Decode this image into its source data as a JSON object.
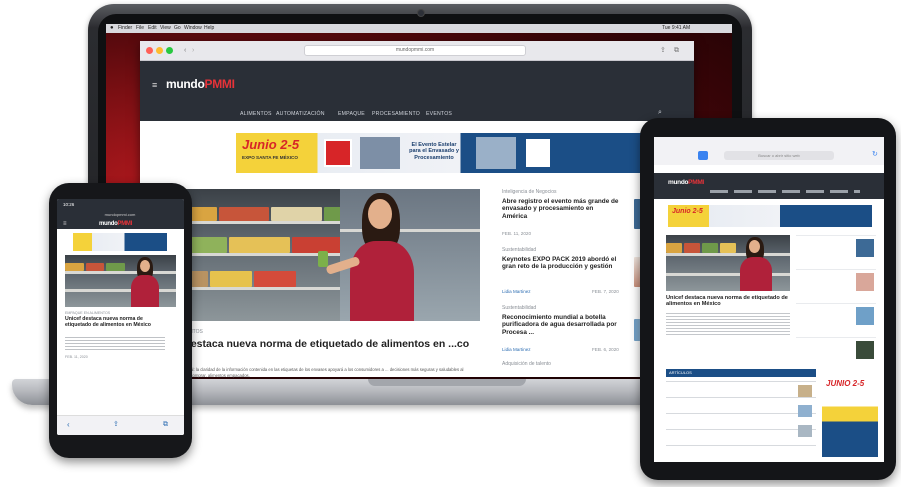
{
  "laptop": {
    "mac_menubar": {
      "items": [
        "Finder",
        "File",
        "Edit",
        "View",
        "Go",
        "Window",
        "Help"
      ],
      "clock": "Tue 9:41 AM"
    },
    "browser": {
      "url": "mundopmmi.com"
    },
    "site": {
      "logo_prefix": "mundo",
      "logo_brand": "PMMI",
      "nav": [
        "ALIMENTOS",
        "AUTOMATIZACIÓN",
        "EMPAQUE",
        "PROCESAMIENTO",
        "EVENTOS"
      ],
      "banner": {
        "date": "Junio 2-5",
        "venue": "EXPO SANTA FE MÉXICO",
        "text": "El Evento Estelar para el Envasado y Procesamiento"
      },
      "featured": {
        "section": "EN ALIMENTOS",
        "headline": "...el destaca nueva norma de etiquetado de alimentos en ...co",
        "excerpt": "...de una cabal: la claridad de la información contenida en las etiquetas de los envases apoyará a los consumidores a ... decisiones más seguras y saludables al momento de comprar. alimentos empacados."
      },
      "sidebar": [
        {
          "section": "Inteligencia de Negocios",
          "headline": "Abre registro el evento más grande de envasado y procesamiento en América",
          "author": "",
          "date": "FEB. 11, 2020"
        },
        {
          "section": "Sustentabilidad",
          "headline": "Keynotes EXPO PACK 2019 abordó el gran reto de la producción y gestión",
          "author": "Lidia Martinez",
          "date": "FEB. 7, 2020"
        },
        {
          "section": "Sustentabilidad",
          "headline": "Reconocimiento mundial a botella purificadora de agua desarrollada por Procesa ...",
          "author": "Lidia Martinez",
          "date": "FEB. 6, 2020"
        },
        {
          "section": "Adquisición de talento",
          "headline": "",
          "author": "",
          "date": ""
        }
      ]
    }
  },
  "phone": {
    "status_time": "10:26",
    "url": "mundopmmi.com",
    "article_section": "EMPAQUE EN ALIMENTOS",
    "headline": "Unicef destaca nueva norma de etiquetado de alimentos en México",
    "date": "FEB. 11, 2020"
  },
  "tablet": {
    "search_placeholder": "Buscar o abrir sitio web",
    "headline": "Unicef destaca nueva norma de etiquetado de alimentos en México",
    "section_bar": "ARTÍCULOS",
    "side_banner_date": "JUNIO 2-5"
  },
  "colors": {
    "brand_red": "#d72528",
    "header_dark": "#2a2f37",
    "banner_yellow": "#f4d23a",
    "banner_blue": "#1b4e86"
  }
}
